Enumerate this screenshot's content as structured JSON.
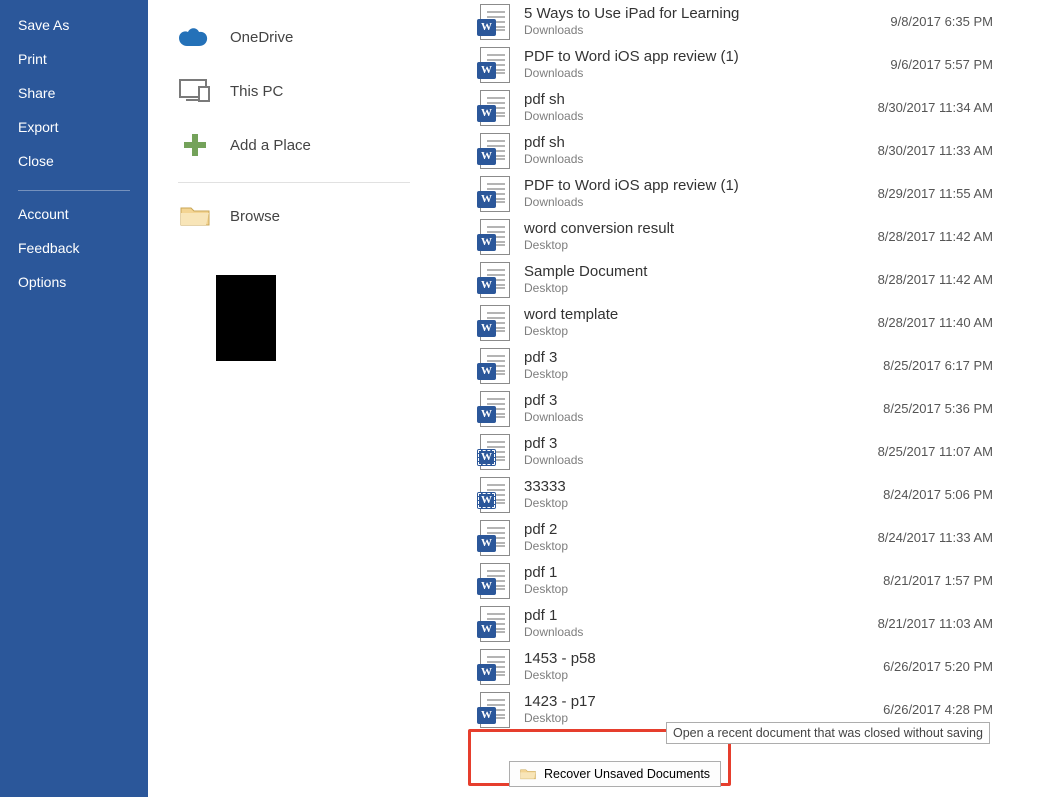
{
  "sidebar": {
    "items": [
      {
        "label": "Save As"
      },
      {
        "label": "Print"
      },
      {
        "label": "Share"
      },
      {
        "label": "Export"
      },
      {
        "label": "Close"
      }
    ],
    "bottom": [
      {
        "label": "Account"
      },
      {
        "label": "Feedback"
      },
      {
        "label": "Options"
      }
    ]
  },
  "places": {
    "items": [
      {
        "icon": "onedrive",
        "label": "OneDrive"
      },
      {
        "icon": "thispc",
        "label": "This PC"
      },
      {
        "icon": "addplace",
        "label": "Add a Place"
      },
      {
        "icon": "browse",
        "label": "Browse"
      }
    ]
  },
  "files": {
    "rows": [
      {
        "name": "5 Ways to Use iPad for Learning",
        "loc": "Downloads",
        "time": "9/8/2017 6:35 PM"
      },
      {
        "name": "PDF to Word iOS app review (1)",
        "loc": "Downloads",
        "time": "9/6/2017 5:57 PM"
      },
      {
        "name": "pdf sh",
        "loc": "Downloads",
        "time": "8/30/2017 11:34 AM"
      },
      {
        "name": "pdf sh",
        "loc": "Downloads",
        "time": "8/30/2017 11:33 AM"
      },
      {
        "name": "PDF to Word iOS app review (1)",
        "loc": "Downloads",
        "time": "8/29/2017 11:55 AM"
      },
      {
        "name": "word conversion result",
        "loc": "Desktop",
        "time": "8/28/2017 11:42 AM"
      },
      {
        "name": "Sample Document",
        "loc": "Desktop",
        "time": "8/28/2017 11:42 AM"
      },
      {
        "name": "word template",
        "loc": "Desktop",
        "time": "8/28/2017 11:40 AM"
      },
      {
        "name": "pdf 3",
        "loc": "Desktop",
        "time": "8/25/2017 6:17 PM"
      },
      {
        "name": "pdf 3",
        "loc": "Downloads",
        "time": "8/25/2017 5:36 PM"
      },
      {
        "name": "pdf 3",
        "loc": "Downloads",
        "time": "8/25/2017 11:07 AM",
        "dashed": true
      },
      {
        "name": "33333",
        "loc": "Desktop",
        "time": "8/24/2017 5:06 PM",
        "dashed": true
      },
      {
        "name": "pdf 2",
        "loc": "Desktop",
        "time": "8/24/2017 11:33 AM"
      },
      {
        "name": "pdf 1",
        "loc": "Desktop",
        "time": "8/21/2017 1:57 PM"
      },
      {
        "name": "pdf 1",
        "loc": "Downloads",
        "time": "8/21/2017 11:03 AM"
      },
      {
        "name": "1453 - p58",
        "loc": "Desktop",
        "time": "6/26/2017 5:20 PM"
      },
      {
        "name": "1423 - p17",
        "loc": "Desktop",
        "time": "6/26/2017 4:28 PM"
      }
    ]
  },
  "recover": {
    "button_label": "Recover Unsaved Documents",
    "tooltip": "Open a recent document that was closed without saving"
  }
}
